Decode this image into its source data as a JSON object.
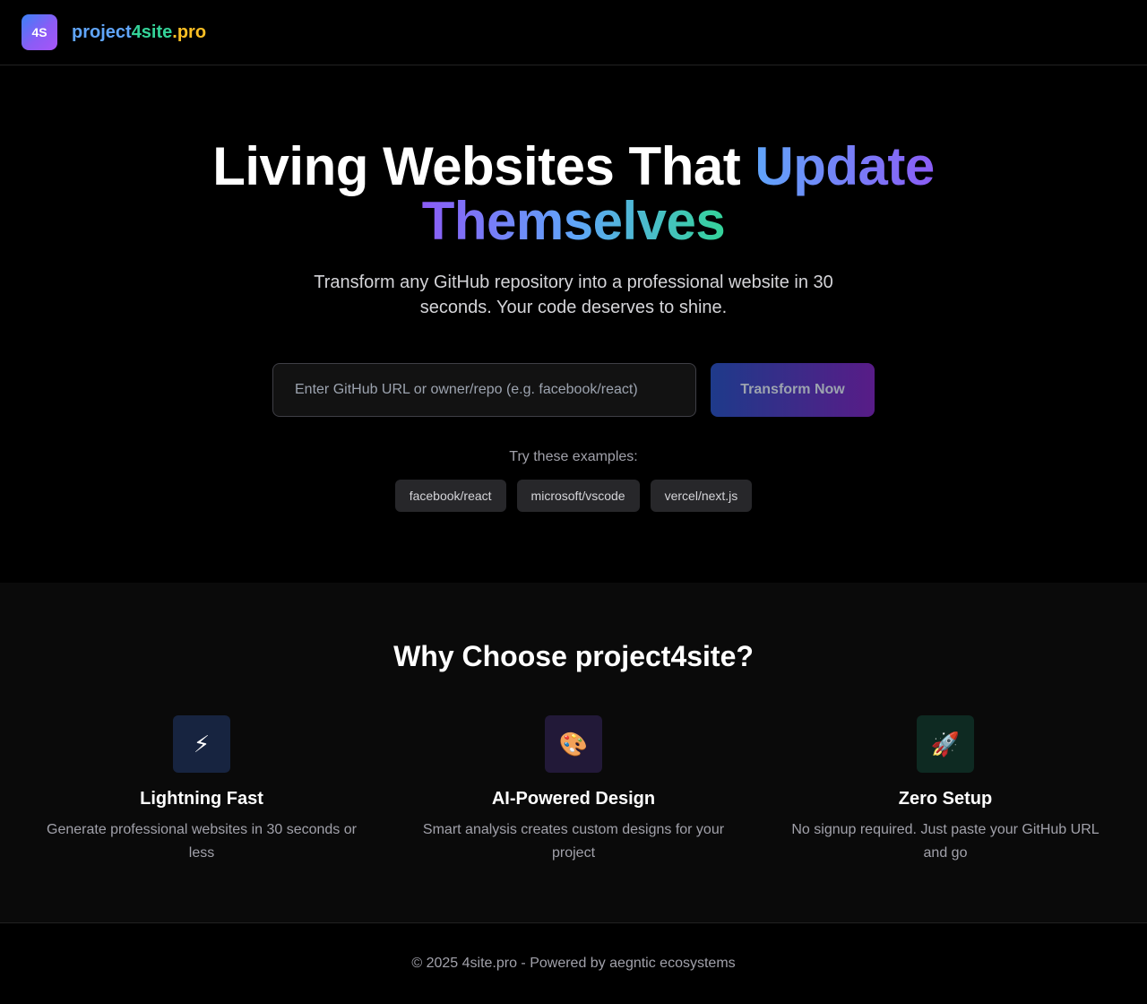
{
  "header": {
    "logo_text": "4S",
    "brand_part1": "project",
    "brand_part2": "4site",
    "brand_part3": ".pro"
  },
  "hero": {
    "title_white": "Living Websites That ",
    "title_grad1": "Update",
    "title_grad2": "Themselves",
    "subtitle": "Transform any GitHub repository into a professional website in 30 seconds. Your code deserves to shine.",
    "input_placeholder": "Enter GitHub URL or owner/repo (e.g. facebook/react)",
    "input_value": "",
    "button_label": "Transform Now",
    "examples_label": "Try these examples:",
    "examples": [
      "facebook/react",
      "microsoft/vscode",
      "vercel/next.js"
    ]
  },
  "features": {
    "title": "Why Choose project4site?",
    "items": [
      {
        "icon": "lightning-icon",
        "glyph": "⚡",
        "bg": "#172440",
        "name": "Lightning Fast",
        "desc": "Generate professional websites in 30 seconds or less"
      },
      {
        "icon": "palette-icon",
        "glyph": "🎨",
        "bg": "#221938",
        "name": "AI-Powered Design",
        "desc": "Smart analysis creates custom designs for your project"
      },
      {
        "icon": "rocket-icon",
        "glyph": "🚀",
        "bg": "#0e2a22",
        "name": "Zero Setup",
        "desc": "No signup required. Just paste your GitHub URL and go"
      }
    ]
  },
  "footer": {
    "text": "© 2025 4site.pro - Powered by aegntic ecosystems"
  },
  "colors": {
    "brand_blue": "#60a5fa",
    "brand_green": "#34d399",
    "brand_yellow": "#fbbf24",
    "accent_purple": "#8b5cf6"
  }
}
